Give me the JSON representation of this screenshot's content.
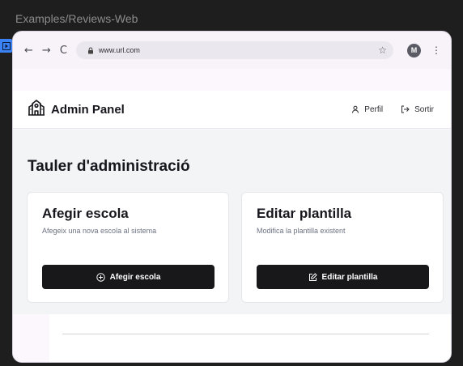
{
  "canvas": {
    "label": "Examples/Reviews-Web"
  },
  "browser": {
    "url": "www.url.com",
    "profile_initial": "M",
    "back_glyph": "←",
    "forward_glyph": "→",
    "reload_glyph": "C",
    "star_glyph": "☆",
    "menu_glyph": "⋮"
  },
  "header": {
    "brand": "Admin Panel",
    "profile_label": "Perfil",
    "logout_label": "Sortir"
  },
  "main": {
    "title": "Tauler d'administració",
    "cards": [
      {
        "title": "Afegir escola",
        "description": "Afegeix una nova escola al sistema",
        "button": "Afegir escola",
        "icon": "plus-circle-icon"
      },
      {
        "title": "Editar plantilla",
        "description": "Modifica la plantilla existent",
        "button": "Editar plantilla",
        "icon": "edit-square-icon"
      }
    ]
  },
  "colors": {
    "primary_button": "#18181b",
    "frame_marker": "#3b82f6",
    "canvas_bg": "#1e1e1e"
  }
}
